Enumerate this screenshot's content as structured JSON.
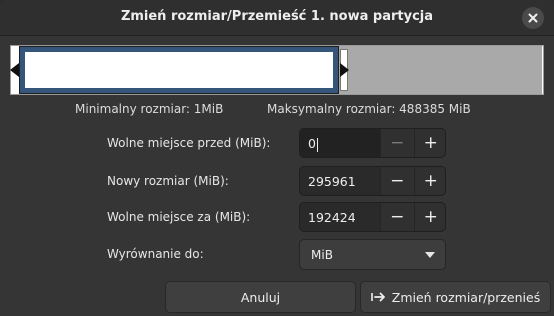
{
  "dialog": {
    "title": "Zmień rozmiar/Przemieść 1. nowa partycja",
    "close_icon": "close-icon"
  },
  "partition_bar": {
    "used_fraction": 0.6,
    "colors": {
      "partition_border": "#35557a",
      "partition_fill": "#ffffff",
      "free_space": "#a9a9a9"
    }
  },
  "info": {
    "min_size": "Minimalny rozmiar: 1MiB",
    "max_size": "Maksymalny rozmiar: 488385 MiB"
  },
  "fields": {
    "free_before": {
      "label": "Wolne miejsce przed (MiB):",
      "value": "0"
    },
    "new_size": {
      "label": "Nowy rozmiar (MiB):",
      "value": "295961"
    },
    "free_after": {
      "label": "Wolne miejsce za (MiB):",
      "value": "192424"
    },
    "align": {
      "label": "Wyrównanie do:",
      "value": "MiB"
    }
  },
  "spin_buttons": {
    "minus": "−",
    "plus": "+"
  },
  "buttons": {
    "cancel": "Anuluj",
    "apply": "Zmień rozmiar/przenieś"
  }
}
